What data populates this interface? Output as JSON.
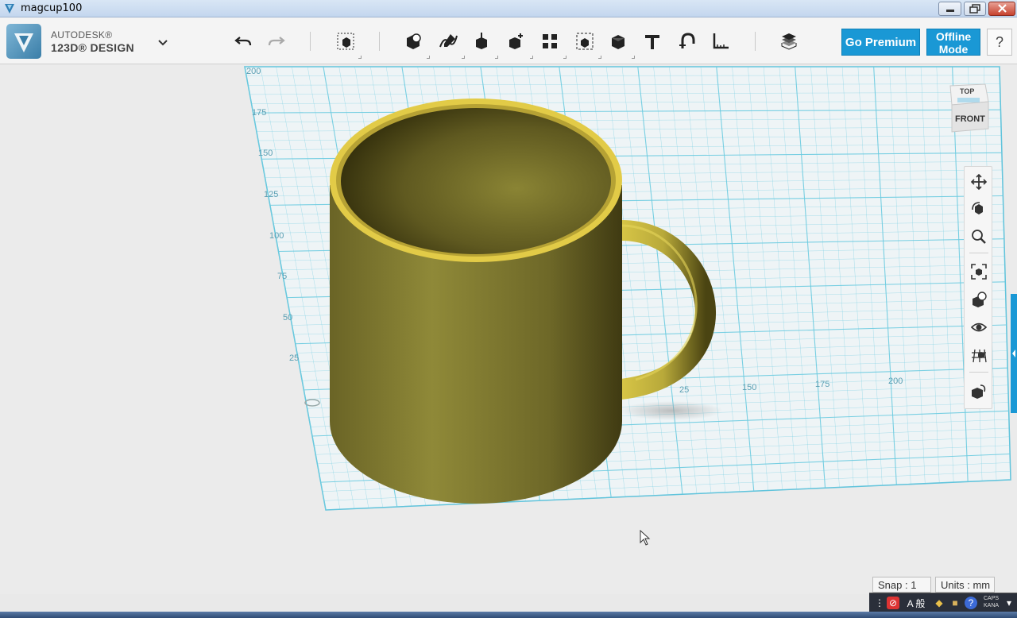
{
  "window": {
    "title": "magcup100"
  },
  "brand": {
    "line1": "AUTODESK®",
    "line2": "123D® DESIGN"
  },
  "toolbar": {
    "icons": [
      "undo-icon",
      "redo-icon",
      "transform-icon",
      "primitives-icon",
      "sketch-icon",
      "construct-icon",
      "modify-icon",
      "pattern-icon",
      "group-icon",
      "combine-icon",
      "text-icon",
      "snap-icon",
      "measure-icon",
      "materials-icon"
    ],
    "premium_label": "Go Premium",
    "offline_line1": "Offline",
    "offline_line2": "Mode",
    "help_label": "?"
  },
  "viewcube": {
    "top_label": "TOP",
    "front_label": "FRONT"
  },
  "grid": {
    "y_labels": [
      "200",
      "175",
      "150",
      "125",
      "100",
      "75",
      "50",
      "25"
    ],
    "x_labels": [
      "25",
      "150",
      "175",
      "200"
    ]
  },
  "nav": {
    "items": [
      "pan-icon",
      "orbit-icon",
      "zoom-icon",
      "fit-icon",
      "views-icon",
      "visibility-icon",
      "grid-view-icon",
      "material-icon"
    ]
  },
  "status": {
    "snap": "Snap : 1",
    "units": "Units : mm"
  },
  "tray": {
    "ime_label": "A 般",
    "caps": "CAPS",
    "kana": "KANA"
  },
  "colors": {
    "accent": "#1a98d5",
    "grid_line": "#6ccbe0",
    "mug": "#8a8434",
    "rim": "#e8d04a"
  }
}
